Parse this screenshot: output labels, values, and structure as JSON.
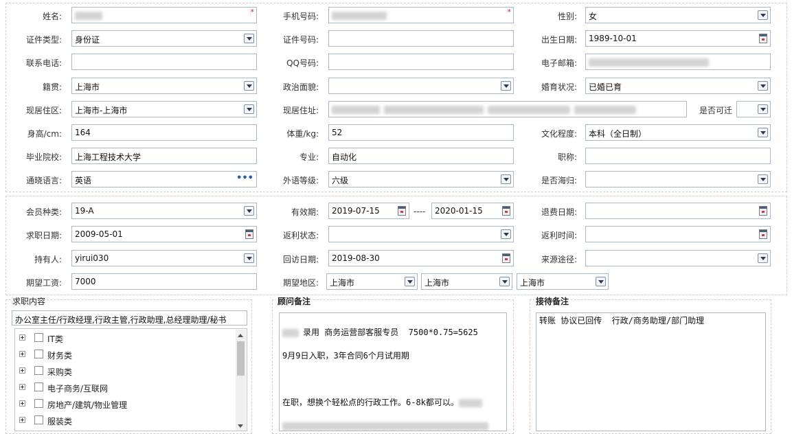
{
  "personal": {
    "name_label": "姓名:",
    "mobile_label": "手机号码:",
    "gender_label": "性别:",
    "gender_value": "女",
    "idtype_label": "证件类型:",
    "idtype_value": "身份证",
    "idno_label": "证件号码:",
    "birth_label": "出生日期:",
    "birth_value": "1989-10-01",
    "phone_label": "联系电话:",
    "qq_label": "QQ号码:",
    "email_label": "电子邮箱:",
    "native_label": "籍贯:",
    "native_value": "上海市",
    "political_label": "政治面貌:",
    "marital_label": "婚育状况:",
    "marital_value": "已婚已育",
    "residence_label": "现居住区:",
    "residence_value": "上海市-上海市",
    "address_label": "现居住址:",
    "relocate_label": "是否可迁",
    "height_label": "身高/cm:",
    "height_value": "164",
    "weight_label": "体重/kg:",
    "weight_value": "52",
    "education_label": "文化程度:",
    "education_value": "本科（全日制）",
    "school_label": "毕业院校:",
    "school_value": "上海工程技术大学",
    "major_label": "专业:",
    "major_value": "自动化",
    "title_label": "职称:",
    "language_label": "通晓语言:",
    "language_value": "英语",
    "langlevel_label": "外语等级:",
    "langlevel_value": "六级",
    "returnee_label": "是否海归:",
    "required_mark": "*"
  },
  "membership": {
    "type_label": "会员种类:",
    "type_value": "19-A",
    "validity_label": "有效期:",
    "valid_from": "2019-07-15",
    "range_sep": "----",
    "valid_to": "2020-01-15",
    "refund_label": "退费日期:",
    "jobdate_label": "求职日期:",
    "jobdate_value": "2009-05-01",
    "rebate_status_label": "返利状态:",
    "rebate_time_label": "返利时间:",
    "holder_label": "持有人:",
    "holder_value": "yirui030",
    "visit_label": "回访日期:",
    "visit_value": "2019-08-30",
    "source_label": "来源途径:",
    "salary_label": "期望工资:",
    "salary_value": "7000",
    "region_label": "期望地区:",
    "region_values": [
      "上海市",
      "上海市",
      "上海市"
    ]
  },
  "job_content": {
    "title": "求职内容",
    "summary": "办公室主任/行政经理,行政主管,行政助理,总经理助理/秘书",
    "categories": [
      "IT类",
      "财务类",
      "采购类",
      "电子商务/互联网",
      "房地产/建筑/物业管理",
      "服装类"
    ]
  },
  "advisor_note": {
    "title": "顾问备注",
    "line1": "录用 商务运营部客服专员  7500*0.75=5625",
    "line2": "9月9日入职，3年合同6个月试用期",
    "line3": "在职，想换个轻松点的行政工作。6-8k都可以。"
  },
  "reception_note": {
    "title": "接待备注",
    "text": "转账 协议已回传  行政/商务助理/部门助理"
  }
}
